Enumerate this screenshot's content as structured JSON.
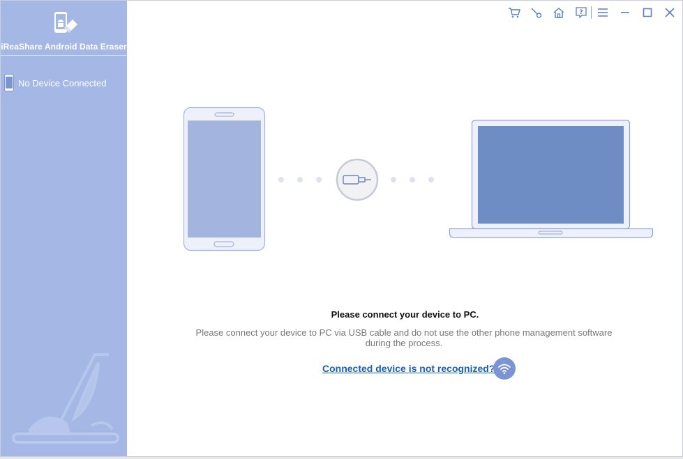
{
  "app": {
    "title": "iReaShare Android Data Eraser"
  },
  "sidebar": {
    "device_status": "No Device Connected"
  },
  "toolbar": {
    "icons": [
      "cart-icon",
      "key-icon",
      "home-icon",
      "help-icon",
      "menu-icon",
      "minimize-icon",
      "maximize-icon",
      "close-icon"
    ]
  },
  "main": {
    "connect_title": "Please connect your device to PC.",
    "connect_instructions": "Please connect your device to PC via USB cable and do not use the other phone management software during the process.",
    "help_link": "Connected device is not recognized?"
  },
  "colors": {
    "sidebar_bg": "#a5b7e4",
    "accent": "#7b95d4",
    "link": "#1a5fb4"
  }
}
